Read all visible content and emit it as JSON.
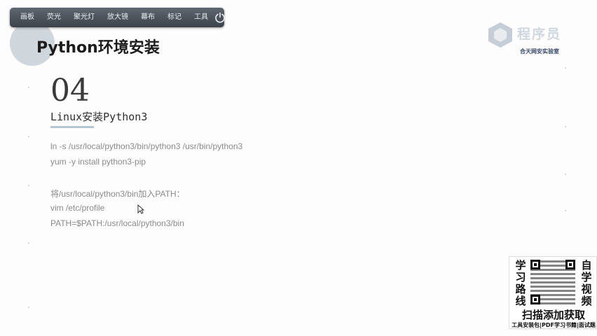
{
  "toolbar": {
    "items": [
      "画板",
      "荧光",
      "聚光灯",
      "放大镜",
      "幕布",
      "标记",
      "工具"
    ],
    "power_icon": "power-icon"
  },
  "slide": {
    "title": "Python环境安装",
    "section_number": "04",
    "section_title": "Linux安装Python3",
    "lines": [
      "ln -s /usr/local/python3/bin/python3 /usr/bin/python3",
      "yum -y install python3-pip",
      "将/usr/local/python3/bin加入PATH：",
      "vim /etc/profile",
      "PATH=$PATH:/usr/local/python3/bin"
    ]
  },
  "logo": {
    "text": "程序员",
    "sub": "合天网安实验室"
  },
  "ad": {
    "left": [
      "学",
      "习",
      "路",
      "线"
    ],
    "right": [
      "自",
      "学",
      "视",
      "频"
    ],
    "main": "扫描添加获取",
    "bottom": "工具安装包|PDF学习书籍|面试题"
  },
  "colors": {
    "toolbar": "#4b525a",
    "page": "#fdfdfd",
    "text_gray": "#8a8a8a"
  }
}
